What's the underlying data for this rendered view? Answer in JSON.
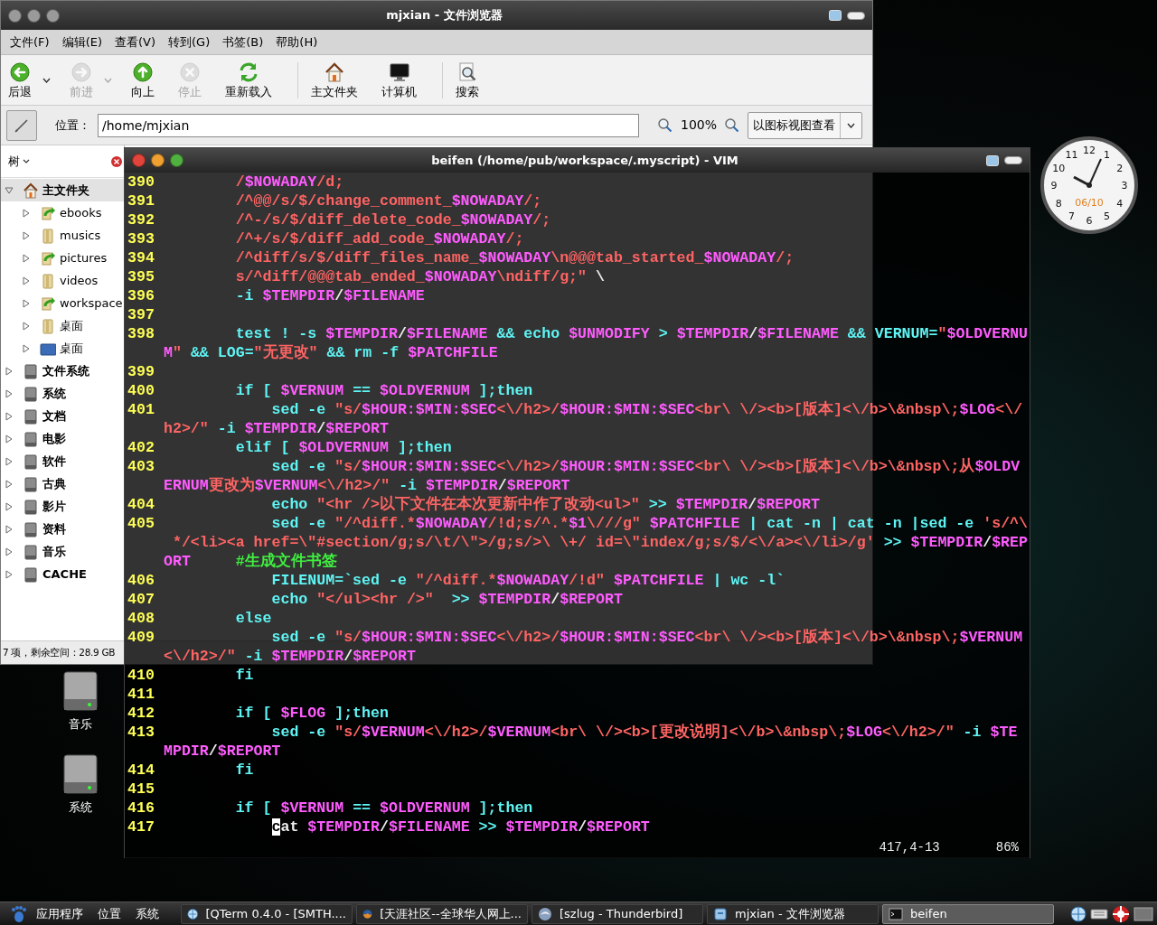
{
  "file_manager": {
    "title": "mjxian - 文件浏览器",
    "menu": [
      "文件(F)",
      "编辑(E)",
      "查看(V)",
      "转到(G)",
      "书签(B)",
      "帮助(H)"
    ],
    "toolbar": [
      [
        {
          "label": "后退",
          "kind": "back",
          "disabled": false,
          "dropdown": true
        },
        {
          "label": "前进",
          "kind": "forward",
          "disabled": true,
          "dropdown": true
        },
        {
          "label": "向上",
          "kind": "up",
          "disabled": false,
          "dropdown": false
        },
        {
          "label": "停止",
          "kind": "stop",
          "disabled": true,
          "dropdown": false
        },
        {
          "label": "重新载入",
          "kind": "reload",
          "disabled": false,
          "dropdown": false
        }
      ],
      [
        {
          "label": "主文件夹",
          "kind": "home",
          "disabled": false,
          "dropdown": false
        },
        {
          "label": "计算机",
          "kind": "computer",
          "disabled": false,
          "dropdown": false
        }
      ],
      [
        {
          "label": "搜索",
          "kind": "search",
          "disabled": false,
          "dropdown": false
        }
      ]
    ],
    "location": {
      "label": "位置：",
      "value": "/home/mjxian",
      "zoom": "100%",
      "view": "以图标视图查看"
    },
    "sidebar": {
      "title": "树",
      "tree": [
        {
          "label": "主文件夹",
          "kind": "home",
          "expanded": true,
          "selected": true,
          "children": [
            {
              "label": "ebooks",
              "kind": "synced-folder",
              "expanded": false
            },
            {
              "label": "musics",
              "kind": "folder",
              "expanded": false
            },
            {
              "label": "pictures",
              "kind": "synced-folder",
              "expanded": false
            },
            {
              "label": "videos",
              "kind": "folder",
              "expanded": false
            },
            {
              "label": "workspace",
              "kind": "synced-folder",
              "expanded": false
            },
            {
              "label": "桌面",
              "kind": "folder",
              "expanded": false
            },
            {
              "label": "桌面",
              "kind": "desktop-folder",
              "expanded": false
            }
          ]
        },
        {
          "label": "文件系统",
          "kind": "drive",
          "expanded": false,
          "selected": false
        },
        {
          "label": "系统",
          "kind": "drive",
          "expanded": false,
          "selected": false
        },
        {
          "label": "文档",
          "kind": "drive",
          "expanded": false,
          "selected": false
        },
        {
          "label": "电影",
          "kind": "drive",
          "expanded": false,
          "selected": false
        },
        {
          "label": "软件",
          "kind": "drive",
          "expanded": false,
          "selected": false
        },
        {
          "label": "古典",
          "kind": "drive",
          "expanded": false,
          "selected": false
        },
        {
          "label": "影片",
          "kind": "drive",
          "expanded": false,
          "selected": false
        },
        {
          "label": "资料",
          "kind": "drive",
          "expanded": false,
          "selected": false
        },
        {
          "label": "音乐",
          "kind": "drive",
          "expanded": false,
          "selected": false
        },
        {
          "label": "CACHE",
          "kind": "drive",
          "expanded": false,
          "selected": false
        }
      ]
    },
    "status_bar": "7 项，剩余空间：28.9 GB"
  },
  "vim": {
    "title": "beifen (/home/pub/workspace/.myscript) - VIM",
    "lines": [
      {
        "number": "390",
        "rows": [
          {
            "segments": [
              {
                "kind": "string",
                "text": "        /"
              },
              {
                "kind": "variable",
                "text": "$NOWADAY"
              },
              {
                "kind": "string",
                "text": "/d;"
              }
            ]
          }
        ]
      },
      {
        "number": "391",
        "rows": [
          {
            "segments": [
              {
                "kind": "string",
                "text": "        /^@@/s/$/change_comment_"
              },
              {
                "kind": "variable",
                "text": "$NOWADAY"
              },
              {
                "kind": "string",
                "text": "/;"
              }
            ]
          }
        ]
      },
      {
        "number": "392",
        "rows": [
          {
            "segments": [
              {
                "kind": "string",
                "text": "        /^-/s/$/diff_delete_code_"
              },
              {
                "kind": "variable",
                "text": "$NOWADAY"
              },
              {
                "kind": "string",
                "text": "/;"
              }
            ]
          }
        ]
      },
      {
        "number": "393",
        "rows": [
          {
            "segments": [
              {
                "kind": "string",
                "text": "        /^+/s/$/diff_add_code_"
              },
              {
                "kind": "variable",
                "text": "$NOWADAY"
              },
              {
                "kind": "string",
                "text": "/;"
              }
            ]
          }
        ]
      },
      {
        "number": "394",
        "rows": [
          {
            "segments": [
              {
                "kind": "string",
                "text": "        /^diff/s/$/diff_files_name_"
              },
              {
                "kind": "variable",
                "text": "$NOWADAY"
              },
              {
                "kind": "string",
                "text": "\\n@@@tab_started_"
              },
              {
                "kind": "variable",
                "text": "$NOWADAY"
              },
              {
                "kind": "string",
                "text": "/;"
              }
            ]
          }
        ]
      },
      {
        "number": "395",
        "rows": [
          {
            "segments": [
              {
                "kind": "string",
                "text": "        s/^diff/@@@tab_ended_"
              },
              {
                "kind": "variable",
                "text": "$NOWADAY"
              },
              {
                "kind": "string",
                "text": "\\ndiff/g;\""
              },
              {
                "kind": "plain",
                "text": " \\"
              }
            ]
          }
        ]
      },
      {
        "number": "396",
        "rows": [
          {
            "segments": [
              {
                "kind": "keyword",
                "text": "        -i "
              },
              {
                "kind": "variable",
                "text": "$TEMPDIR"
              },
              {
                "kind": "plain",
                "text": "/"
              },
              {
                "kind": "variable",
                "text": "$FILENAME"
              }
            ]
          }
        ]
      },
      {
        "number": "397"
      },
      {
        "number": "398",
        "rows": [
          {
            "segments": [
              {
                "kind": "keyword",
                "text": "        test ! -s "
              },
              {
                "kind": "variable",
                "text": "$TEMPDIR"
              },
              {
                "kind": "plain",
                "text": "/"
              },
              {
                "kind": "variable",
                "text": "$FILENAME"
              },
              {
                "kind": "keyword",
                "text": " && echo "
              },
              {
                "kind": "variable",
                "text": "$UNMODIFY"
              },
              {
                "kind": "keyword",
                "text": " > "
              },
              {
                "kind": "variable",
                "text": "$TEMPDIR"
              },
              {
                "kind": "plain",
                "text": "/"
              },
              {
                "kind": "variable",
                "text": "$FILENAME"
              },
              {
                "kind": "keyword",
                "text": " && VERNUM="
              },
              {
                "kind": "string",
                "text": "\""
              },
              {
                "kind": "variable",
                "text": "$OLDVERNU"
              }
            ]
          },
          {
            "segments": [
              {
                "kind": "variable",
                "text": "M"
              },
              {
                "kind": "string",
                "text": "\""
              },
              {
                "kind": "keyword",
                "text": " && LOG="
              },
              {
                "kind": "string",
                "text": "\"无更改\""
              },
              {
                "kind": "keyword",
                "text": " && rm -f "
              },
              {
                "kind": "variable",
                "text": "$PATCHFILE"
              }
            ]
          }
        ]
      },
      {
        "number": "399"
      },
      {
        "number": "400",
        "rows": [
          {
            "segments": [
              {
                "kind": "keyword",
                "text": "        if [ "
              },
              {
                "kind": "variable",
                "text": "$VERNUM"
              },
              {
                "kind": "keyword",
                "text": " == "
              },
              {
                "kind": "variable",
                "text": "$OLDVERNUM"
              },
              {
                "kind": "keyword",
                "text": " ];then"
              }
            ]
          }
        ]
      },
      {
        "number": "401",
        "rows": [
          {
            "segments": [
              {
                "kind": "keyword",
                "text": "            sed -e "
              },
              {
                "kind": "string",
                "text": "\"s/"
              },
              {
                "kind": "variable",
                "text": "$HOUR:$MIN:$SEC"
              },
              {
                "kind": "string",
                "text": "<\\/h2>/"
              },
              {
                "kind": "variable",
                "text": "$HOUR:$MIN:$SEC"
              },
              {
                "kind": "string",
                "text": "<br\\ \\/><b>[版本]<\\/b>\\&nbsp\\;"
              },
              {
                "kind": "variable",
                "text": "$LOG"
              },
              {
                "kind": "string",
                "text": "<\\/"
              }
            ]
          },
          {
            "segments": [
              {
                "kind": "string",
                "text": "h2>/\""
              },
              {
                "kind": "keyword",
                "text": " -i "
              },
              {
                "kind": "variable",
                "text": "$TEMPDIR"
              },
              {
                "kind": "plain",
                "text": "/"
              },
              {
                "kind": "variable",
                "text": "$REPORT"
              }
            ]
          }
        ]
      },
      {
        "number": "402",
        "rows": [
          {
            "segments": [
              {
                "kind": "keyword",
                "text": "        elif [ "
              },
              {
                "kind": "variable",
                "text": "$OLDVERNUM"
              },
              {
                "kind": "keyword",
                "text": " ];then"
              }
            ]
          }
        ]
      },
      {
        "number": "403",
        "rows": [
          {
            "segments": [
              {
                "kind": "keyword",
                "text": "            sed -e "
              },
              {
                "kind": "string",
                "text": "\"s/"
              },
              {
                "kind": "variable",
                "text": "$HOUR:$MIN:$SEC"
              },
              {
                "kind": "string",
                "text": "<\\/h2>/"
              },
              {
                "kind": "variable",
                "text": "$HOUR:$MIN:$SEC"
              },
              {
                "kind": "string",
                "text": "<br\\ \\/><b>[版本]<\\/b>\\&nbsp\\;从"
              },
              {
                "kind": "variable",
                "text": "$OLDV"
              }
            ]
          },
          {
            "segments": [
              {
                "kind": "variable",
                "text": "ERNUM"
              },
              {
                "kind": "string",
                "text": "更改为"
              },
              {
                "kind": "variable",
                "text": "$VERNUM"
              },
              {
                "kind": "string",
                "text": "<\\/h2>/\""
              },
              {
                "kind": "keyword",
                "text": " -i "
              },
              {
                "kind": "variable",
                "text": "$TEMPDIR"
              },
              {
                "kind": "plain",
                "text": "/"
              },
              {
                "kind": "variable",
                "text": "$REPORT"
              }
            ]
          }
        ]
      },
      {
        "number": "404",
        "rows": [
          {
            "segments": [
              {
                "kind": "keyword",
                "text": "            echo "
              },
              {
                "kind": "string",
                "text": "\"<hr />以下文件在本次更新中作了改动<ul>\""
              },
              {
                "kind": "keyword",
                "text": " >> "
              },
              {
                "kind": "variable",
                "text": "$TEMPDIR"
              },
              {
                "kind": "plain",
                "text": "/"
              },
              {
                "kind": "variable",
                "text": "$REPORT"
              }
            ]
          }
        ]
      },
      {
        "number": "405",
        "rows": [
          {
            "segments": [
              {
                "kind": "keyword",
                "text": "            sed -e "
              },
              {
                "kind": "string",
                "text": "\"/^diff.*"
              },
              {
                "kind": "variable",
                "text": "$NOWADAY"
              },
              {
                "kind": "string",
                "text": "/!d;s/^.*"
              },
              {
                "kind": "variable",
                "text": "$1"
              },
              {
                "kind": "string",
                "text": "\\///g\" "
              },
              {
                "kind": "variable",
                "text": "$PATCHFILE"
              },
              {
                "kind": "keyword",
                "text": " | cat -n | cat -n |sed -e "
              },
              {
                "kind": "string",
                "text": "'s/^\\"
              }
            ]
          },
          {
            "segments": [
              {
                "kind": "string",
                "text": " */<li><a href=\\\"#section/g;s/\\t/\\\">/g;s/>\\ \\+/ id=\\\"index/g;s/$/<\\/a><\\/li>/g'"
              },
              {
                "kind": "keyword",
                "text": " >> "
              },
              {
                "kind": "variable",
                "text": "$TEMPDIR"
              },
              {
                "kind": "plain",
                "text": "/"
              },
              {
                "kind": "variable",
                "text": "$REP"
              }
            ]
          },
          {
            "segments": [
              {
                "kind": "variable",
                "text": "ORT"
              },
              {
                "kind": "comment",
                "text": "     #生成文件书签"
              }
            ]
          }
        ]
      },
      {
        "number": "406",
        "rows": [
          {
            "segments": [
              {
                "kind": "keyword",
                "text": "            FILENUM=`sed -e "
              },
              {
                "kind": "string",
                "text": "\"/^diff.*"
              },
              {
                "kind": "variable",
                "text": "$NOWADAY"
              },
              {
                "kind": "string",
                "text": "/!d\" "
              },
              {
                "kind": "variable",
                "text": "$PATCHFILE"
              },
              {
                "kind": "keyword",
                "text": " | wc -l`"
              }
            ]
          }
        ]
      },
      {
        "number": "407",
        "rows": [
          {
            "segments": [
              {
                "kind": "keyword",
                "text": "            echo "
              },
              {
                "kind": "string",
                "text": "\"</ul><hr />\""
              },
              {
                "kind": "keyword",
                "text": "  >> "
              },
              {
                "kind": "variable",
                "text": "$TEMPDIR"
              },
              {
                "kind": "plain",
                "text": "/"
              },
              {
                "kind": "variable",
                "text": "$REPORT"
              }
            ]
          }
        ]
      },
      {
        "number": "408",
        "rows": [
          {
            "segments": [
              {
                "kind": "keyword",
                "text": "        else"
              }
            ]
          }
        ]
      },
      {
        "number": "409",
        "rows": [
          {
            "segments": [
              {
                "kind": "keyword",
                "text": "            sed -e "
              },
              {
                "kind": "string",
                "text": "\"s/"
              },
              {
                "kind": "variable",
                "text": "$HOUR:$MIN:$SEC"
              },
              {
                "kind": "string",
                "text": "<\\/h2>/"
              },
              {
                "kind": "variable",
                "text": "$HOUR:$MIN:$SEC"
              },
              {
                "kind": "string",
                "text": "<br\\ \\/><b>[版本]<\\/b>\\&nbsp\\;"
              },
              {
                "kind": "variable",
                "text": "$VERNUM"
              }
            ]
          },
          {
            "segments": [
              {
                "kind": "string",
                "text": "<\\/h2>/\""
              },
              {
                "kind": "keyword",
                "text": " -i "
              },
              {
                "kind": "variable",
                "text": "$TEMPDIR"
              },
              {
                "kind": "plain",
                "text": "/"
              },
              {
                "kind": "variable",
                "text": "$REPORT"
              }
            ]
          }
        ]
      },
      {
        "number": "410",
        "rows": [
          {
            "segments": [
              {
                "kind": "keyword",
                "text": "        fi"
              }
            ]
          }
        ]
      },
      {
        "number": "411"
      },
      {
        "number": "412",
        "rows": [
          {
            "segments": [
              {
                "kind": "keyword",
                "text": "        if [ "
              },
              {
                "kind": "variable",
                "text": "$FLOG"
              },
              {
                "kind": "keyword",
                "text": " ];then"
              }
            ]
          }
        ]
      },
      {
        "number": "413",
        "rows": [
          {
            "segments": [
              {
                "kind": "keyword",
                "text": "            sed -e "
              },
              {
                "kind": "string",
                "text": "\"s/"
              },
              {
                "kind": "variable",
                "text": "$VERNUM"
              },
              {
                "kind": "string",
                "text": "<\\/h2>/"
              },
              {
                "kind": "variable",
                "text": "$VERNUM"
              },
              {
                "kind": "string",
                "text": "<br\\ \\/><b>[更改说明]<\\/b>\\&nbsp\\;"
              },
              {
                "kind": "variable",
                "text": "$LOG"
              },
              {
                "kind": "string",
                "text": "<\\/h2>/\""
              },
              {
                "kind": "keyword",
                "text": " -i "
              },
              {
                "kind": "variable",
                "text": "$TE"
              }
            ]
          },
          {
            "segments": [
              {
                "kind": "variable",
                "text": "MPDIR"
              },
              {
                "kind": "plain",
                "text": "/"
              },
              {
                "kind": "variable",
                "text": "$REPORT"
              }
            ]
          }
        ]
      },
      {
        "number": "414",
        "rows": [
          {
            "segments": [
              {
                "kind": "keyword",
                "text": "        fi"
              }
            ]
          }
        ]
      },
      {
        "number": "415"
      },
      {
        "number": "416",
        "rows": [
          {
            "segments": [
              {
                "kind": "keyword",
                "text": "        if [ "
              },
              {
                "kind": "variable",
                "text": "$VERNUM"
              },
              {
                "kind": "keyword",
                "text": " == "
              },
              {
                "kind": "variable",
                "text": "$OLDVERNUM"
              },
              {
                "kind": "keyword",
                "text": " ];then"
              }
            ]
          }
        ]
      },
      {
        "number": "417",
        "rows": [
          {
            "segments": [
              {
                "kind": "cursor",
                "text": "            c"
              },
              {
                "kind": "plain",
                "text": "at "
              },
              {
                "kind": "variable",
                "text": "$TEMPDIR"
              },
              {
                "kind": "plain",
                "text": "/"
              },
              {
                "kind": "variable",
                "text": "$FILENAME"
              },
              {
                "kind": "keyword",
                "text": " >> "
              },
              {
                "kind": "variable",
                "text": "$TEMPDIR"
              },
              {
                "kind": "plain",
                "text": "/"
              },
              {
                "kind": "variable",
                "text": "$REPORT"
              }
            ]
          }
        ]
      }
    ],
    "ruler": {
      "position": "417,4-13",
      "percent": "86%"
    }
  },
  "clock": {
    "numerals": [
      "12",
      "11",
      "1",
      "10",
      "2",
      "9",
      "3",
      "8",
      "4",
      "7",
      "5",
      "6"
    ],
    "date": "06/10"
  },
  "desktop_icons": [
    {
      "label": "音乐"
    },
    {
      "label": "系统"
    }
  ],
  "taskbar": {
    "menus": [
      "应用程序",
      "位置",
      "系统"
    ],
    "tasks": [
      {
        "label": "[QTerm 0.4.0 - [SMTH....",
        "kind": "terminal",
        "selected": false
      },
      {
        "label": "[天涯社区--全球华人网上...",
        "kind": "browser",
        "selected": false
      },
      {
        "label": "[szlug - Thunderbird]",
        "kind": "mail",
        "selected": false
      },
      {
        "label": "mjxian - 文件浏览器",
        "kind": "files",
        "selected": false
      },
      {
        "label": "beifen",
        "kind": "editor",
        "selected": true
      }
    ]
  }
}
